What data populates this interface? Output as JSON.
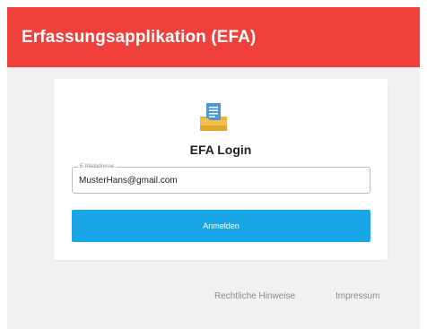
{
  "header": {
    "title": "Erfassungsapplikation (EFA)"
  },
  "login": {
    "logo_icon": "document-folder-icon",
    "title": "EFA Login",
    "email_label": "E-Mailadresse",
    "email_value": "MusterHans@gmail.com",
    "submit_label": "Anmelden"
  },
  "footer": {
    "links": [
      "Rechtliche Hinweise",
      "Impressum"
    ]
  },
  "colors": {
    "header_bg": "#f0403c",
    "button_bg": "#1aa5e6",
    "page_bg": "#f1f1f1",
    "icon_folder": "#e8b43a",
    "icon_document": "#4f97d4"
  }
}
